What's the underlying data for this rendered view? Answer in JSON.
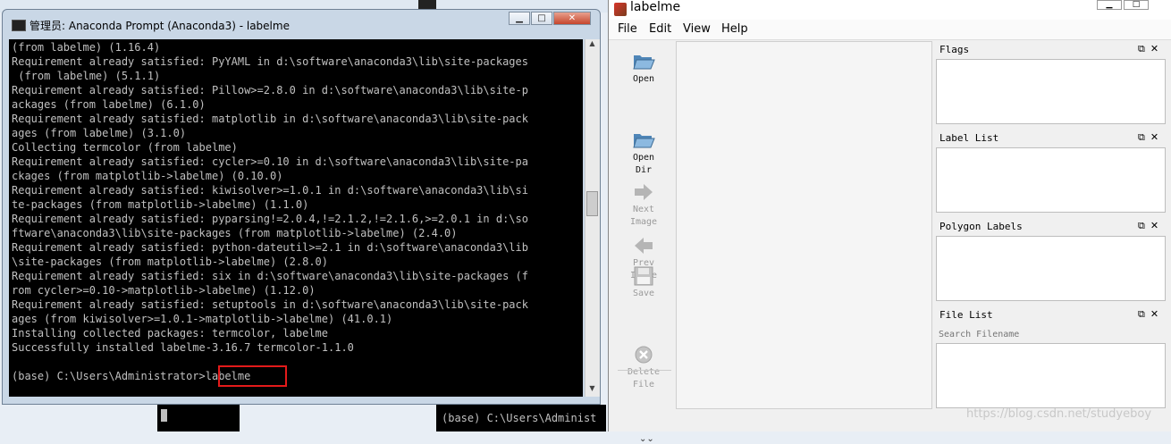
{
  "terminal": {
    "title": "管理员: Anaconda Prompt (Anaconda3) - labelme",
    "lines": [
      "(from labelme) (1.16.4)",
      "Requirement already satisfied: PyYAML in d:\\software\\anaconda3\\lib\\site-packages",
      " (from labelme) (5.1.1)",
      "Requirement already satisfied: Pillow>=2.8.0 in d:\\software\\anaconda3\\lib\\site-p",
      "ackages (from labelme) (6.1.0)",
      "Requirement already satisfied: matplotlib in d:\\software\\anaconda3\\lib\\site-pack",
      "ages (from labelme) (3.1.0)",
      "Collecting termcolor (from labelme)",
      "Requirement already satisfied: cycler>=0.10 in d:\\software\\anaconda3\\lib\\site-pa",
      "ckages (from matplotlib->labelme) (0.10.0)",
      "Requirement already satisfied: kiwisolver>=1.0.1 in d:\\software\\anaconda3\\lib\\si",
      "te-packages (from matplotlib->labelme) (1.1.0)",
      "Requirement already satisfied: pyparsing!=2.0.4,!=2.1.2,!=2.1.6,>=2.0.1 in d:\\so",
      "ftware\\anaconda3\\lib\\site-packages (from matplotlib->labelme) (2.4.0)",
      "Requirement already satisfied: python-dateutil>=2.1 in d:\\software\\anaconda3\\lib",
      "\\site-packages (from matplotlib->labelme) (2.8.0)",
      "Requirement already satisfied: six in d:\\software\\anaconda3\\lib\\site-packages (f",
      "rom cycler>=0.10->matplotlib->labelme) (1.12.0)",
      "Requirement already satisfied: setuptools in d:\\software\\anaconda3\\lib\\site-pack",
      "ages (from kiwisolver>=1.0.1->matplotlib->labelme) (41.0.1)",
      "Installing collected packages: termcolor, labelme",
      "Successfully installed labelme-3.16.7 termcolor-1.1.0",
      "",
      "(base) C:\\Users\\Administrator>labelme"
    ],
    "highlighted_command": "labelme"
  },
  "background_terminal": {
    "line": "(base) C:\\Users\\Administ"
  },
  "labelme": {
    "title": "labelme",
    "menu": [
      "File",
      "Edit",
      "View",
      "Help"
    ],
    "tools": [
      {
        "label": "Open",
        "icon": "folder-open-icon",
        "enabled": true
      },
      {
        "label": "Open\nDir",
        "icon": "folder-open-icon",
        "enabled": true
      },
      {
        "label": "Next\nImage",
        "icon": "arrow-right-icon",
        "enabled": false
      },
      {
        "label": "Prev\nImage",
        "icon": "arrow-left-icon",
        "enabled": false
      },
      {
        "label": "Save",
        "icon": "floppy-disk-icon",
        "enabled": false
      },
      {
        "label": "Delete\nFile",
        "icon": "delete-circle-icon",
        "enabled": false
      }
    ],
    "docks": {
      "flags": "Flags",
      "label_list": "Label List",
      "polygon_labels": "Polygon Labels",
      "file_list": "File List"
    },
    "search_placeholder": "Search Filename"
  },
  "watermark": "https://blog.csdn.net/studyeboy",
  "colors": {
    "terminal_bg": "#000000",
    "terminal_text": "#c0c0c0",
    "highlight_box": "#e31a1a"
  }
}
